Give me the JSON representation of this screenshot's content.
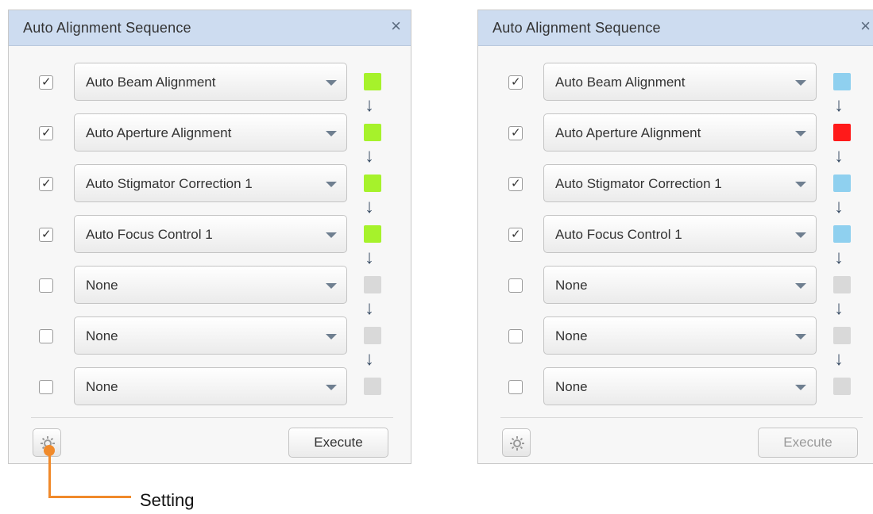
{
  "panels": [
    {
      "title": "Auto Alignment Sequence",
      "close_glyph": "×",
      "execute_label": "Execute",
      "execute_enabled": true,
      "rows": [
        {
          "checked": true,
          "value": "Auto Beam Alignment",
          "status_color": "#a6f22b"
        },
        {
          "checked": true,
          "value": "Auto Aperture Alignment",
          "status_color": "#a6f22b"
        },
        {
          "checked": true,
          "value": "Auto Stigmator Correction 1",
          "status_color": "#a6f22b"
        },
        {
          "checked": true,
          "value": "Auto Focus Control 1",
          "status_color": "#a6f22b"
        },
        {
          "checked": false,
          "value": "None",
          "status_color": "#d9d9d9"
        },
        {
          "checked": false,
          "value": "None",
          "status_color": "#d9d9d9"
        },
        {
          "checked": false,
          "value": "None",
          "status_color": "#d9d9d9"
        }
      ]
    },
    {
      "title": "Auto Alignment Sequence",
      "close_glyph": "×",
      "execute_label": "Execute",
      "execute_enabled": false,
      "rows": [
        {
          "checked": true,
          "value": "Auto Beam Alignment",
          "status_color": "#8fd0ef"
        },
        {
          "checked": true,
          "value": "Auto Aperture Alignment",
          "status_color": "#ff1a1a"
        },
        {
          "checked": true,
          "value": "Auto Stigmator Correction 1",
          "status_color": "#8fd0ef"
        },
        {
          "checked": true,
          "value": "Auto Focus Control 1",
          "status_color": "#8fd0ef"
        },
        {
          "checked": false,
          "value": "None",
          "status_color": "#d9d9d9"
        },
        {
          "checked": false,
          "value": "None",
          "status_color": "#d9d9d9"
        },
        {
          "checked": false,
          "value": "None",
          "status_color": "#d9d9d9"
        }
      ]
    }
  ],
  "icons": {
    "checkmark": "✓",
    "arrow_down": "↓",
    "gear": "gear-icon"
  },
  "callout": {
    "label": "Setting",
    "color": "#f08a2b"
  }
}
